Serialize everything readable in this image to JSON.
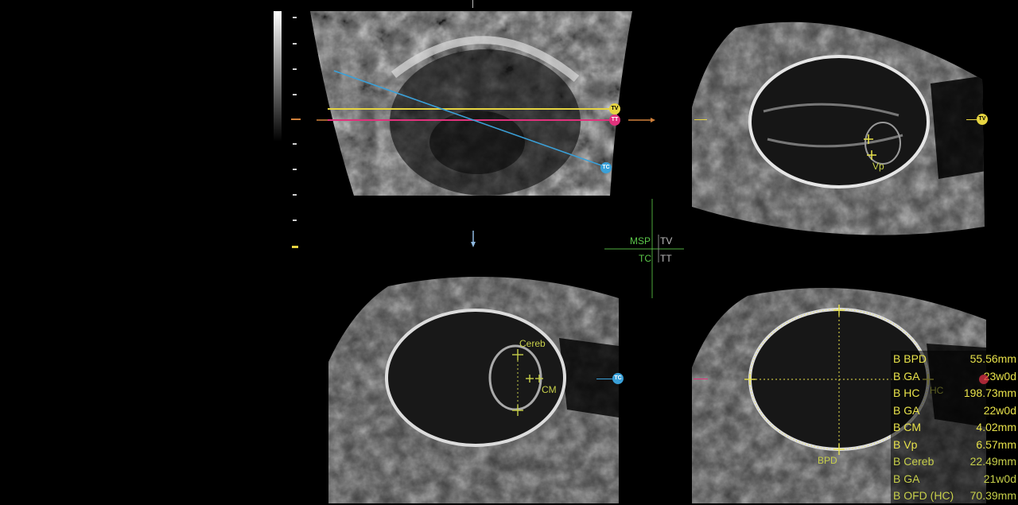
{
  "viewer": {
    "colors": {
      "accent_yellow": "#e8e24a",
      "plane_tv": "#e6d441",
      "plane_tt": "#e0317b",
      "plane_tc": "#3aa0d8",
      "crosshair_green": "#5bc84a"
    }
  },
  "orientation": {
    "msp": "MSP",
    "tv": "TV",
    "tc": "TC",
    "tt": "TT"
  },
  "reference_panel": {
    "tags": {
      "tv": "TV",
      "tt": "TT",
      "tc": "TC"
    }
  },
  "panel_tv": {
    "tag": "TV",
    "caliper_label": "Vp"
  },
  "panel_tc": {
    "tag": "TC",
    "cereb_label": "Cereb",
    "cm_label": "CM"
  },
  "panel_tt": {
    "hc_label": "HC",
    "bpd_label": "BPD"
  },
  "measurements": [
    {
      "name": "B BPD",
      "value": "55.56mm"
    },
    {
      "name": "B GA",
      "value": "23w0d"
    },
    {
      "name": "B HC",
      "value": "198.73mm"
    },
    {
      "name": "B GA",
      "value": "22w0d"
    },
    {
      "name": "B CM",
      "value": "4.02mm"
    },
    {
      "name": "B Vp",
      "value": "6.57mm"
    },
    {
      "name": "B Cereb",
      "value": "22.49mm"
    },
    {
      "name": "B GA",
      "value": "21w0d"
    },
    {
      "name": "B OFD (HC)",
      "value": "70.39mm"
    }
  ]
}
